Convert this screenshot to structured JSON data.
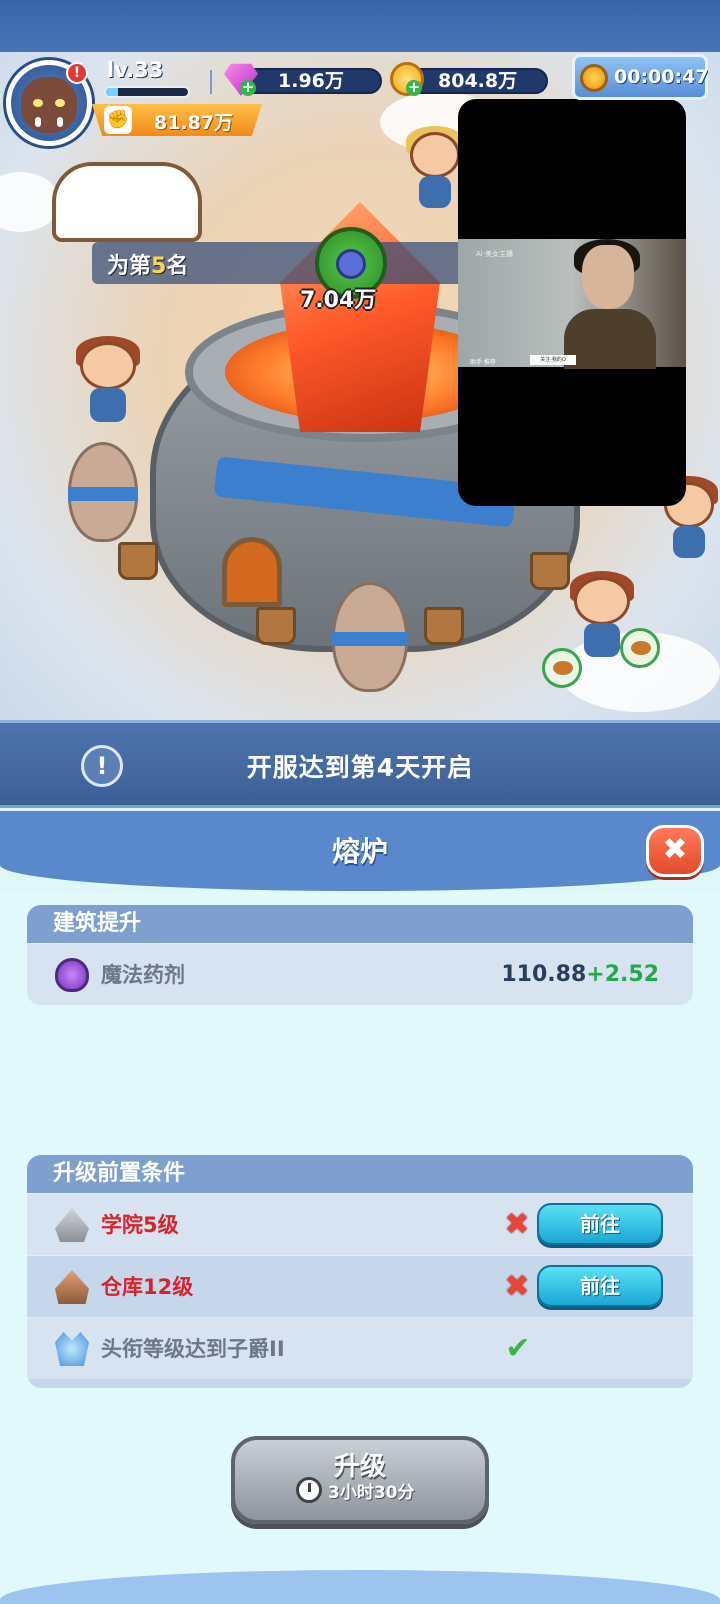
{
  "hud": {
    "level": "lv.33",
    "xp_fraction": 0.15,
    "power": "81.87万",
    "gems": "1.96万",
    "gold": "804.8万",
    "timer": "00:00:47",
    "alert_badge": "!"
  },
  "scene": {
    "rank_prefix": "为第",
    "rank_number": "5",
    "rank_suffix": "名",
    "potion_amount": "7.04万"
  },
  "video": {
    "small_text": "Ai·美女主播",
    "caption_text": "助手·推荐",
    "button_text": "关注·我的Q"
  },
  "notice": {
    "icon": "!",
    "text": "开服达到第4天开启"
  },
  "dialog": {
    "title": "熔炉",
    "close_icon": "✖",
    "building_bonus": {
      "header": "建筑提升",
      "item_label": "魔法药剂",
      "item_icon": "potion-icon",
      "base_value": "110.88",
      "bonus_value": "+2.52"
    },
    "prerequisites": {
      "header": "升级前置条件",
      "items": [
        {
          "label": "学院5级",
          "met": false,
          "icon": "academy-icon",
          "status_symbol": "✖",
          "button": "前往"
        },
        {
          "label": "仓库12级",
          "met": false,
          "icon": "warehouse-icon",
          "status_symbol": "✖",
          "button": "前往"
        },
        {
          "label": "头衔等级达到子爵II",
          "met": true,
          "icon": "crown-icon",
          "status_symbol": "✔"
        }
      ]
    },
    "upgrade": {
      "label": "升级",
      "time": "3小时30分",
      "icon": "clock-icon"
    }
  },
  "colors": {
    "accent_blue": "#5a88cc",
    "unmet_red": "#d8232a",
    "bonus_green": "#27a74a",
    "go_button": "#1aa8d4"
  }
}
